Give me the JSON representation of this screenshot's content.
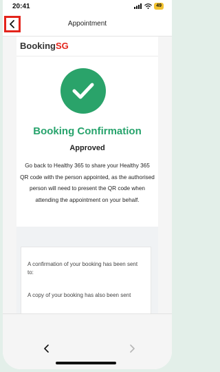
{
  "status_bar": {
    "time": "20:41",
    "battery": "49"
  },
  "header": {
    "title": "Appointment"
  },
  "logo": {
    "prefix": "Booking",
    "suffix": "SG"
  },
  "confirmation": {
    "title": "Booking Confirmation",
    "status": "Approved",
    "instructions": "Go back to Healthy 365 to share your Healthy 365 QR code with the person appointed, as the authorised person will need to present the QR code when attending the appointment on your behalf."
  },
  "info_box": {
    "line1": "A confirmation of your booking has been sent to:",
    "line2": "A copy of your booking has also been sent"
  },
  "colors": {
    "accent_green": "#2aa36a",
    "brand_red": "#e3241b"
  },
  "icons": {
    "back": "chevron-left-icon",
    "success": "checkmark-icon",
    "browser_back": "chevron-left-icon",
    "browser_forward": "chevron-right-icon"
  }
}
